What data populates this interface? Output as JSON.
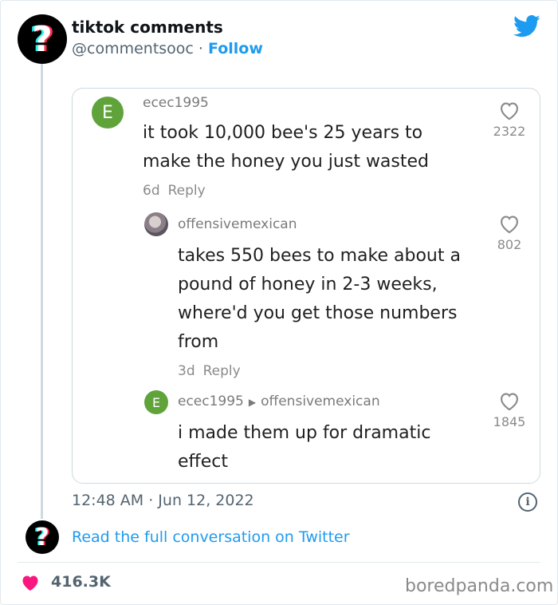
{
  "tweet": {
    "author_name": "tiktok comments",
    "author_handle": "@commentsooc",
    "separator": "·",
    "follow_label": "Follow",
    "timestamp": "12:48 AM · Jun 12, 2022",
    "read_more": "Read the full conversation on Twitter",
    "likes": "416.3K",
    "info_glyph": "i"
  },
  "avatar_glyph": "?",
  "comments": [
    {
      "avatar_letter": "E",
      "user": "ecec1995",
      "text_lines": [
        "it took 10,000 bee's 25 years to",
        "make the honey you just wasted"
      ],
      "age": "6d",
      "reply_label": "Reply",
      "likes": "2322"
    },
    {
      "user": "offensivemexican",
      "text_lines": [
        "takes 550 bees to make about a",
        "pound of honey in 2-3 weeks,",
        "where'd you get those numbers",
        "from"
      ],
      "age": "3d",
      "reply_label": "Reply",
      "likes": "802"
    },
    {
      "avatar_letter": "E",
      "user": "ecec1995",
      "reply_to": "offensivemexican",
      "text_lines": [
        "i made them up for dramatic",
        "effect"
      ],
      "likes": "1845"
    }
  ],
  "watermark": "boredpanda.com",
  "colors": {
    "twitter_blue": "#1d9bf0",
    "like_pink": "#f91880",
    "avatar_green": "#5fa33a"
  },
  "icons": [
    "twitter-bird-icon",
    "heart-outline-icon",
    "heart-filled-icon",
    "info-icon",
    "reply-arrow-icon"
  ]
}
